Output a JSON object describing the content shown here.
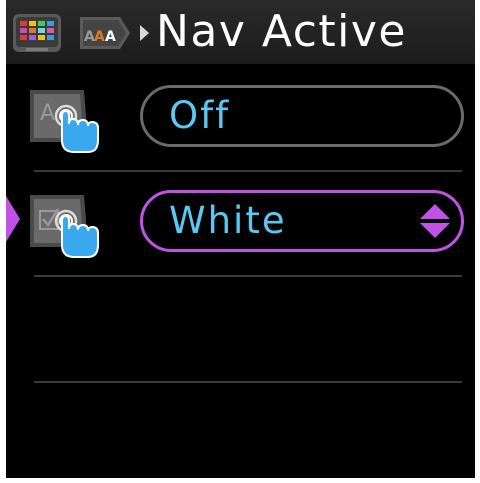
{
  "header": {
    "title": "Nav Active",
    "breadcrumb_icons": [
      "color-grid-icon",
      "text-size-icon"
    ],
    "separator_icon": "chevron-right-icon"
  },
  "settings": [
    {
      "icon": "touch-setting-icon",
      "value": "Off",
      "selected": false
    },
    {
      "icon": "touch-checkbox-icon",
      "value": "White",
      "selected": true,
      "spinner_icon": "up-down-arrows-icon"
    }
  ],
  "colors": {
    "accent": "#c252e6",
    "value_text": "#5ac8f2",
    "inactive_border": "#6a6a6a",
    "background": "#000000",
    "header_bg": "#232323",
    "title_text": "#ffffff"
  }
}
